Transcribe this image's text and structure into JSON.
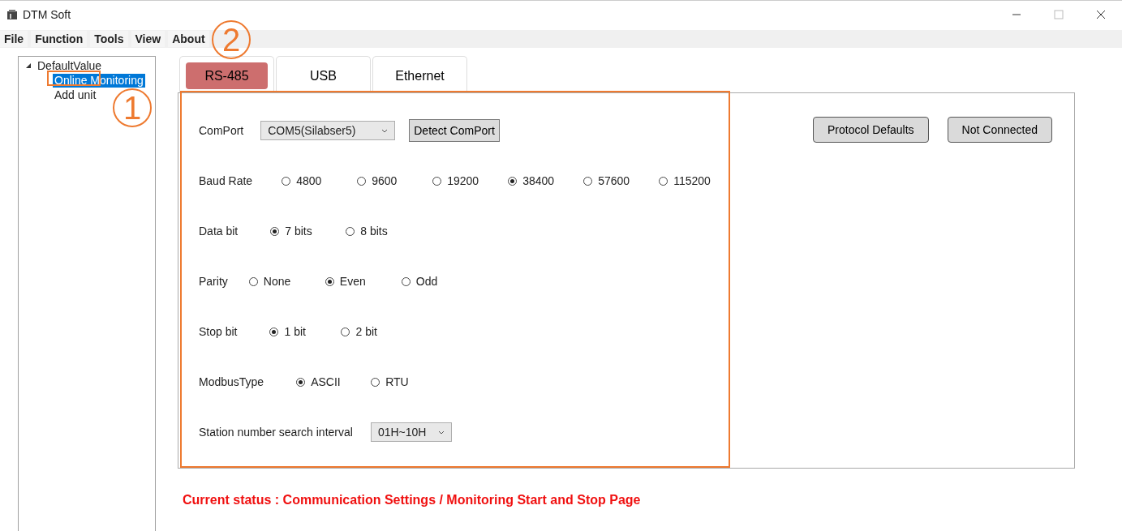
{
  "window": {
    "title": "DTM Soft"
  },
  "menu": [
    "File",
    "Function",
    "Tools",
    "View",
    "About"
  ],
  "tree": [
    {
      "label": "DefaultValue",
      "expanded": true,
      "selected": false,
      "children": [
        {
          "label": "Online Monitoring",
          "selected": true
        },
        {
          "label": "Add unit",
          "selected": false
        }
      ]
    }
  ],
  "tabs": [
    {
      "label": "RS-485",
      "selected": true
    },
    {
      "label": "USB",
      "selected": false
    },
    {
      "label": "Ethernet",
      "selected": false
    }
  ],
  "comport": {
    "label": "ComPort",
    "value": "COM5(Silabser5)",
    "detect_button": "Detect ComPort"
  },
  "radio_groups": [
    {
      "label": "Baud Rate",
      "options": [
        {
          "label": "4800",
          "selected": false
        },
        {
          "label": "9600",
          "selected": false
        },
        {
          "label": "19200",
          "selected": false
        },
        {
          "label": "38400",
          "selected": true
        },
        {
          "label": "57600",
          "selected": false
        },
        {
          "label": "115200",
          "selected": false
        }
      ]
    },
    {
      "label": "Data bit",
      "options": [
        {
          "label": "7 bits",
          "selected": true
        },
        {
          "label": "8 bits",
          "selected": false
        }
      ]
    },
    {
      "label": "Parity",
      "options": [
        {
          "label": "None",
          "selected": false
        },
        {
          "label": "Even",
          "selected": true
        },
        {
          "label": "Odd",
          "selected": false
        }
      ]
    },
    {
      "label": "Stop bit",
      "options": [
        {
          "label": "1 bit",
          "selected": true
        },
        {
          "label": "2 bit",
          "selected": false
        }
      ]
    },
    {
      "label": "ModbusType",
      "options": [
        {
          "label": "ASCII",
          "selected": true
        },
        {
          "label": "RTU",
          "selected": false
        }
      ]
    }
  ],
  "station_interval": {
    "label": "Station number search interval",
    "value": "01H~10H"
  },
  "side_buttons": [
    "Protocol Defaults",
    "Not Connected"
  ],
  "status": "Current status : Communication Settings / Monitoring Start and Stop Page",
  "annotations": [
    {
      "label": "1"
    },
    {
      "label": "2"
    }
  ]
}
